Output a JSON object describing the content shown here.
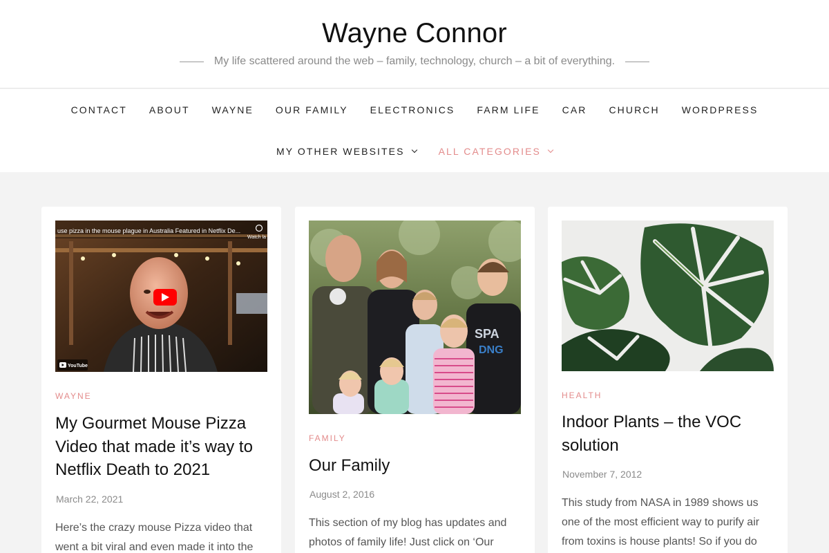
{
  "site": {
    "title": "Wayne Connor",
    "tagline": "My life scattered around the web – family, technology, church – a bit of everything."
  },
  "nav": {
    "row1": [
      "CONTACT",
      "ABOUT",
      "WAYNE",
      "OUR FAMILY",
      "ELECTRONICS",
      "FARM LIFE",
      "CAR",
      "CHURCH",
      "WORDPRESS"
    ],
    "row2": [
      {
        "label": "MY OTHER WEBSITES",
        "dropdown": true
      },
      {
        "label": "ALL CATEGORIES",
        "dropdown": true
      }
    ]
  },
  "colors": {
    "accent": "#e38b8b",
    "background": "#f3f3f3"
  },
  "posts": [
    {
      "category": "WAYNE",
      "title": "My Gourmet Mouse Pizza Video that made it’s way to Netflix Death to 2021",
      "date": "March 22, 2021",
      "excerpt": "Here’s the crazy mouse Pizza video that went a bit viral and even made it into the",
      "thumbnail": {
        "kind": "youtube-video",
        "overlay_title": "use pizza in the mouse plague in Australia Featured in Netflix De...",
        "watch_label": "Watch la",
        "brand": "YouTube"
      }
    },
    {
      "category": "FAMILY",
      "title": "Our Family",
      "date": "August 2, 2016",
      "excerpt": "This section of my blog has updates and photos of family life! Just click on ‘Our",
      "thumbnail": {
        "kind": "family-photo"
      }
    },
    {
      "category": "HEALTH",
      "title": "Indoor Plants – the VOC solution",
      "date": "November 7, 2012",
      "excerpt": "This study from NASA in 1989 shows us one of the most efficient way to purify air from toxins is house plants! So if you do",
      "thumbnail": {
        "kind": "plant-photo"
      }
    }
  ]
}
